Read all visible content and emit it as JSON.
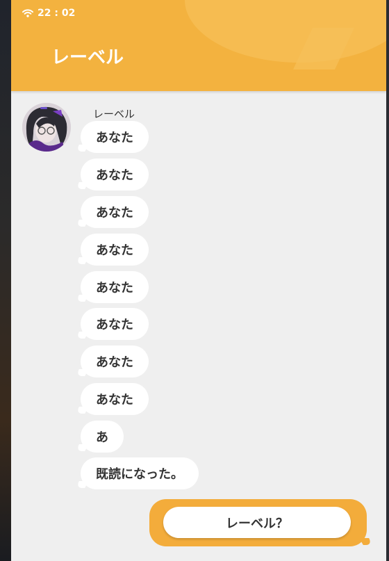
{
  "status_bar": {
    "time": "22 : 02"
  },
  "header": {
    "title": "レーベル"
  },
  "chat": {
    "sender": "レーベル",
    "messages": [
      "あなた",
      "あなた",
      "あなた",
      "あなた",
      "あなた",
      "あなた",
      "あなた",
      "あなた",
      "あ",
      "既読になった。"
    ]
  },
  "reply": {
    "option": "レーベル？"
  },
  "colors": {
    "header": "#f3b23f",
    "reply_panel": "#f3ac3b",
    "chat_background": "#efefef",
    "bubble": "#ffffff",
    "text": "#333333"
  }
}
